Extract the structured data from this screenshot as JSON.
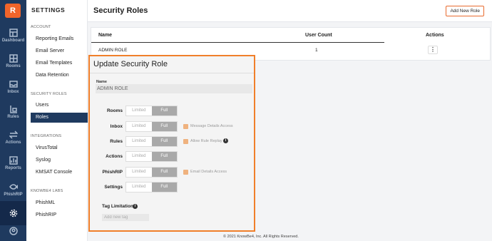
{
  "rail": {
    "logo": "R",
    "items": [
      {
        "label": "Dashboard",
        "icon": "dashboard-icon"
      },
      {
        "label": "Rooms",
        "icon": "rooms-icon"
      },
      {
        "label": "Inbox",
        "icon": "inbox-icon"
      },
      {
        "label": "Rules",
        "icon": "rules-icon"
      },
      {
        "label": "Actions",
        "icon": "actions-icon"
      },
      {
        "label": "Reports",
        "icon": "reports-icon"
      },
      {
        "label": "PhishRIP",
        "icon": "fish-icon"
      },
      {
        "label": "",
        "icon": "gear-icon"
      },
      {
        "label": "",
        "icon": "user-icon"
      }
    ]
  },
  "sidebar": {
    "title": "SETTINGS",
    "sections": [
      {
        "label": "ACCOUNT",
        "items": [
          "Reporting Emails",
          "Email Server",
          "Email Templates",
          "Data Retention"
        ]
      },
      {
        "label": "SECURITY ROLES",
        "items": [
          "Users",
          "Roles"
        ]
      },
      {
        "label": "INTEGRATIONS",
        "items": [
          "VirusTotal",
          "Syslog",
          "KMSAT Console"
        ]
      },
      {
        "label": "KNOWBE4 LABS",
        "items": [
          "PhishML",
          "PhishRIP"
        ]
      }
    ],
    "active": "Roles"
  },
  "header": {
    "title": "Security Roles",
    "add_button": "Add New Role"
  },
  "table": {
    "columns": [
      "Name",
      "User Count",
      "Actions"
    ],
    "rows": [
      {
        "name": "ADMIN ROLE",
        "count": "1",
        "actions": "⋮"
      }
    ]
  },
  "modal": {
    "title": "Update Security Role",
    "name_label": "Name",
    "name_value": "ADMIN ROLE",
    "permissions": [
      {
        "label": "Rooms",
        "limited": "Limited",
        "full": "Full",
        "extra": ""
      },
      {
        "label": "Inbox",
        "limited": "Limited",
        "full": "Full",
        "extra": "Message Details Access"
      },
      {
        "label": "Rules",
        "limited": "Limited",
        "full": "Full",
        "extra": "Allow Rule Replay"
      },
      {
        "label": "Actions",
        "limited": "Limited",
        "full": "Full",
        "extra": ""
      },
      {
        "label": "PhishRIP",
        "limited": "Limited",
        "full": "Full",
        "extra": "Email Details Access"
      },
      {
        "label": "Settings",
        "limited": "Limited",
        "full": "Full",
        "extra": ""
      }
    ],
    "tag_label": "Tag Limitations",
    "tag_placeholder": "Add new tag",
    "info_glyph": "i"
  },
  "footer": "© 2021 KnowBe4, Inc. All Rights Reserved.",
  "colors": {
    "rail": "#1f3a5f",
    "accent": "#f07f2a",
    "logo": "#f1642a"
  }
}
